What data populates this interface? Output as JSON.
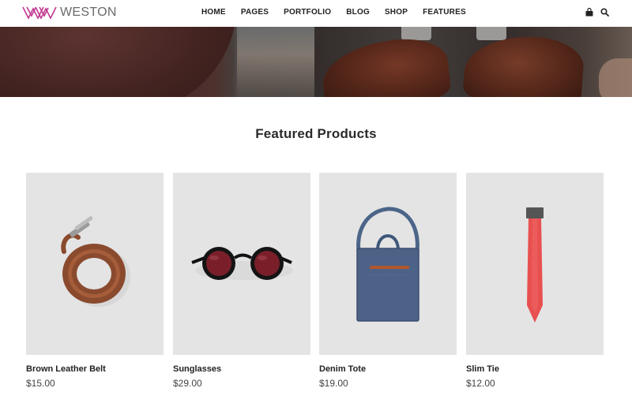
{
  "brand": {
    "name": "WESTON",
    "logo_icon": "w-logo-icon",
    "color": "#c2378f"
  },
  "nav": {
    "items": [
      {
        "label": "HOME"
      },
      {
        "label": "PAGES"
      },
      {
        "label": "PORTFOLIO"
      },
      {
        "label": "BLOG"
      },
      {
        "label": "SHOP"
      },
      {
        "label": "FEATURES"
      }
    ],
    "cart_icon": "shopping-bag-icon",
    "search_icon": "search-icon"
  },
  "featured": {
    "title": "Featured Products",
    "products": [
      {
        "name": "Brown Leather Belt",
        "price": "$15.00",
        "icon": "leather-belt-image"
      },
      {
        "name": "Sunglasses",
        "price": "$29.00",
        "icon": "sunglasses-image"
      },
      {
        "name": "Denim Tote",
        "price": "$19.00",
        "icon": "denim-tote-image"
      },
      {
        "name": "Slim Tie",
        "price": "$12.00",
        "icon": "slim-tie-image"
      }
    ]
  }
}
